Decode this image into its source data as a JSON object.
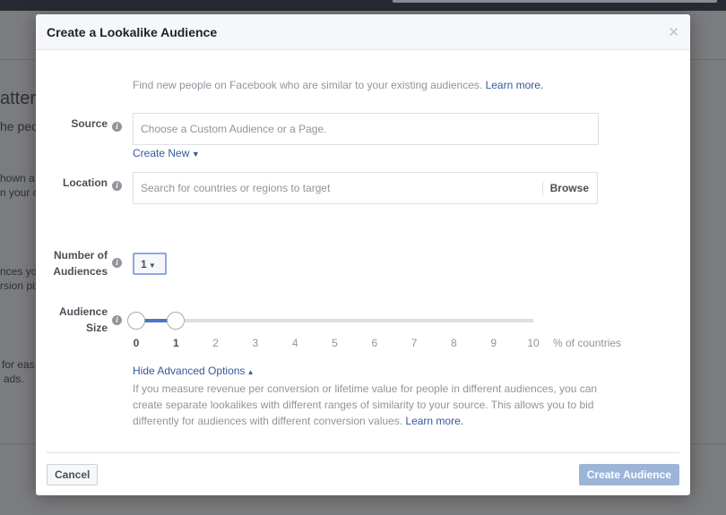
{
  "background": {
    "fragments": [
      "atter",
      "he peo",
      "hown a",
      "n your c",
      "nces you",
      "rsion pix",
      "for eas",
      "ads."
    ]
  },
  "dialog": {
    "title": "Create a Lookalike Audience",
    "close_icon": "close-icon",
    "intro": "Find new people on Facebook who are similar to your existing audiences.",
    "intro_link": "Learn more.",
    "source": {
      "label": "Source",
      "placeholder": "Choose a Custom Audience or a Page.",
      "create_new": "Create New"
    },
    "location": {
      "label": "Location",
      "placeholder": "Search for countries or regions to target",
      "browse": "Browse"
    },
    "number": {
      "label_line1": "Number of",
      "label_line2": "Audiences",
      "value": "1"
    },
    "size": {
      "label_line1": "Audience",
      "label_line2": "Size",
      "ticks": [
        "0",
        "1",
        "2",
        "3",
        "4",
        "5",
        "6",
        "7",
        "8",
        "9",
        "10"
      ],
      "unit": "% of countries",
      "range": [
        0,
        1
      ],
      "accent": "#4a76c8"
    },
    "advanced": {
      "toggle": "Hide Advanced Options",
      "text": "If you measure revenue per conversion or lifetime value for people in different audiences, you can create separate lookalikes with different ranges of similarity to your source. This allows you to bid differently for audiences with different conversion values.",
      "link": "Learn more."
    },
    "cancel": "Cancel",
    "create": "Create Audience"
  }
}
